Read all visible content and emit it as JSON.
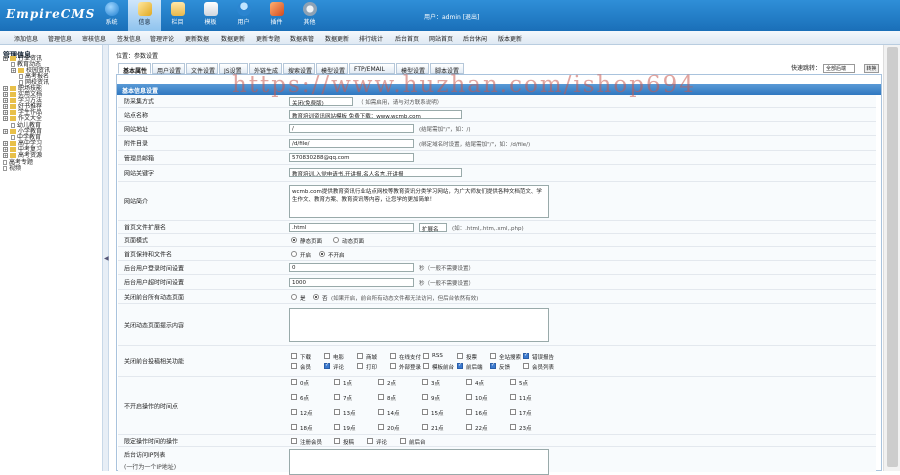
{
  "header": {
    "logo_main": "EmpireCMS",
    "nav": [
      {
        "label": "系统",
        "icon": "globe-icon",
        "color": "#3fa9f5"
      },
      {
        "label": "信息",
        "icon": "edit-icon",
        "color": "#f0c040",
        "active": true
      },
      {
        "label": "栏目",
        "icon": "folder-icon",
        "color": "#f5d06a"
      },
      {
        "label": "模板",
        "icon": "template-icon",
        "color": "#e8e8e8"
      },
      {
        "label": "用户",
        "icon": "user-icon",
        "color": "#4da3e0"
      },
      {
        "label": "插件",
        "icon": "plugin-icon",
        "color": "#e86a3a"
      },
      {
        "label": "其他",
        "icon": "gear-icon",
        "color": "#cfd8e0"
      }
    ],
    "userinfo": "用户：admin   [退出]"
  },
  "menubar": {
    "items": [
      "添加信息",
      "管理信息",
      "审核信息",
      "签发信息",
      "管理评论",
      "更新数据",
      "数据更新",
      "更新专题",
      "数据表管",
      "数据更新",
      "排行统计",
      "后台首页",
      "网站首页",
      "后台休闲",
      "版本更新"
    ],
    "quick_label": "快速跳转：",
    "quick_select": "全部后端",
    "quick_button": "转换"
  },
  "sidebar": {
    "title": "管理信息",
    "nodes": [
      {
        "label": "行业资讯",
        "type": "folder",
        "level": 0
      },
      {
        "label": "教育动态",
        "type": "doc",
        "level": 1
      },
      {
        "label": "校园资讯",
        "type": "folder",
        "level": 1
      },
      {
        "label": "高考报名",
        "type": "doc",
        "level": 2
      },
      {
        "label": "网校资讯",
        "type": "doc",
        "level": 2
      },
      {
        "label": "职场技能",
        "type": "folder",
        "level": 0
      },
      {
        "label": "实用文档",
        "type": "folder",
        "level": 0
      },
      {
        "label": "学习方法",
        "type": "folder",
        "level": 0
      },
      {
        "label": "好书推荐",
        "type": "folder",
        "level": 0
      },
      {
        "label": "学生作品",
        "type": "folder",
        "level": 0
      },
      {
        "label": "作文大全",
        "type": "folder",
        "level": 0
      },
      {
        "label": "幼儿教育",
        "type": "doc",
        "level": 1
      },
      {
        "label": "小学教育",
        "type": "folder",
        "level": 0
      },
      {
        "label": "中学教育",
        "type": "doc",
        "level": 1
      },
      {
        "label": "高中学习",
        "type": "folder",
        "level": 0
      },
      {
        "label": "中考复习",
        "type": "folder",
        "level": 0
      },
      {
        "label": "高考资源",
        "type": "folder",
        "level": 0
      },
      {
        "label": "高考专题",
        "type": "doc",
        "level": 0
      },
      {
        "label": "视频",
        "type": "doc",
        "level": 0
      }
    ]
  },
  "location": "位置：参数设置",
  "tabs": [
    "基本属性",
    "用户设置",
    "文件设置",
    "JS设置",
    "外链生成",
    "搜索设置",
    "模型设置",
    "FTP/EMAIL",
    "模型设置",
    "脚本设置"
  ],
  "panel_title": "基本信息设置",
  "form": {
    "site_type": {
      "label": "防采集方式",
      "value": "关闭(免费版)",
      "hint": "（  如需启用，请与对方联系说明）"
    },
    "site_name": {
      "label": "站点名称",
      "value": "教育培训资讯网站模板 免费下载：www.wcmb.com"
    },
    "site_url": {
      "label": "网站地址",
      "value": "/",
      "hint": "(结尾需加\"/\"，如：/)"
    },
    "news_dir": {
      "label": "附件目录",
      "value": "/d/file/",
      "hint": "(绑定域名时设置，结尾需加\"/\"，如：/d/file/)"
    },
    "admin_email": {
      "label": "管理员邮箱",
      "value": "570830288@qq.com"
    },
    "keywords": {
      "label": "网站关键字",
      "value": "教育培训,入党申请书,开讲报,名人名言,开讲报"
    },
    "description": {
      "label": "网站简介",
      "value": "wcmb.com提供教育资讯行业站点网校等教育资讯分类学习网站，为广大师友们提供各种文档范文、学生作文、教育方案、教育资讯等内容，让您学的更加简单！"
    },
    "index_ext": {
      "label": "首页文件扩展名",
      "value": ".html",
      "select": "扩展名",
      "hint": "(如：.html,.htm,.xml,.php)"
    },
    "page_mode": {
      "label": "页面模式",
      "options": [
        "静态页面",
        "动态页面"
      ],
      "selected": 0
    },
    "index_name": {
      "label": "首页保持和文件名",
      "options": [
        "开启",
        "不开启"
      ],
      "selected": 1
    },
    "login_time": {
      "label": "后台用户登录时间设置",
      "value": "0",
      "hint": "秒（一般不需要设置）"
    },
    "logout_time": {
      "label": "后台用户超时时间设置",
      "value": "1000",
      "hint": "秒（一般不需要设置）"
    },
    "close_site": {
      "label": "关闭前台所有动态页面",
      "options": [
        "是",
        "否"
      ],
      "selected": 1,
      "hint": "(如果开启，前台所有动态文件都无法访问，但后台依然有效)"
    },
    "close_msg": {
      "label": "关闭动态页面提示内容",
      "value": ""
    },
    "close_modules": {
      "label": "关闭前台投稿相关功能",
      "items": [
        {
          "label": "下载",
          "checked": false
        },
        {
          "label": "电影",
          "checked": false
        },
        {
          "label": "商城",
          "checked": false
        },
        {
          "label": "在线支付",
          "checked": false
        },
        {
          "label": "RSS",
          "checked": false
        },
        {
          "label": "投票",
          "checked": false
        },
        {
          "label": "全站搜索",
          "checked": false
        },
        {
          "label": "错误报告",
          "checked": true
        },
        {
          "label": "会员",
          "checked": false
        },
        {
          "label": "评论",
          "checked": true
        },
        {
          "label": "打印",
          "checked": false
        },
        {
          "label": "外部登录",
          "checked": false
        },
        {
          "label": "模板前台",
          "checked": false
        },
        {
          "label": "前后端",
          "checked": true
        },
        {
          "label": "反馈",
          "checked": true
        },
        {
          "label": "会员列表",
          "checked": false
        }
      ]
    },
    "hours": {
      "label": "不开启操作的时间点",
      "items": [
        "0点",
        "1点",
        "2点",
        "3点",
        "4点",
        "5点",
        "6点",
        "7点",
        "8点",
        "9点",
        "10点",
        "11点",
        "12点",
        "13点",
        "14点",
        "15点",
        "16点",
        "17点",
        "18点",
        "19点",
        "20点",
        "21点",
        "22点",
        "23点"
      ]
    },
    "limit_ops": {
      "label": "限定操作时间的操作",
      "items": [
        "注册会员",
        "投稿",
        "评论",
        "前后台"
      ]
    },
    "ip_list": {
      "label": "后台访问IP列表",
      "sublabel": "(一行为一个IP地址)",
      "value": ""
    }
  },
  "watermark": "https://www.huzhan.com/ishop694"
}
